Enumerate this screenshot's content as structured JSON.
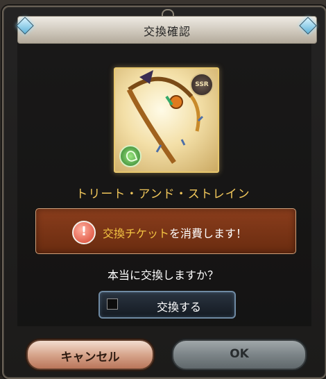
{
  "dialog": {
    "title": "交換確認",
    "item": {
      "name": "トリート・アンド・ストレイン",
      "rarity_badge": "SSR",
      "element_icon": "wind-element-icon"
    },
    "notice": {
      "highlight": "交換チケット",
      "rest": "を消費します！",
      "icon": "warning-icon"
    },
    "question": "本当に交換しますか？",
    "exchange_button_label": "交換する",
    "cancel_button_label": "キャンセル",
    "ok_button_label": "OK"
  },
  "colors": {
    "item_name": "#f1c75b",
    "notice_highlight": "#f3c442",
    "notice_bg": "#7a3416"
  }
}
